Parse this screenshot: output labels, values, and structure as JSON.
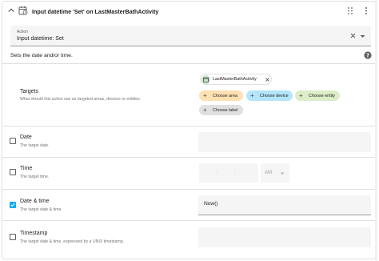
{
  "header": {
    "title": "Input datetime 'Set' on LastMasterBathActivity"
  },
  "action": {
    "label": "Action",
    "value": "Input datetime: Set"
  },
  "description": "Sets the date and/or time.",
  "targets": {
    "title": "Targets",
    "description": "What should this action use as targeted areas, devices or entities.",
    "entity": "LastMasterBathActivity",
    "chips": {
      "area": "Choose area",
      "device": "Choose device",
      "entity": "Choose entity",
      "label": "Choose label"
    }
  },
  "fields": {
    "date": {
      "title": "Date",
      "description": "The target date.",
      "checked": false
    },
    "time": {
      "title": "Time",
      "description": "The target time.",
      "checked": false,
      "ampm": "AM",
      "sep": ":"
    },
    "datetime": {
      "title": "Date & time",
      "description": "The target date & time.",
      "checked": true,
      "value": "Now()"
    },
    "timestamp": {
      "title": "Timestamp",
      "description": "The target date & time, expressed by a UNIX timestamp.",
      "checked": false
    }
  },
  "colors": {
    "accent": "#03a9f4",
    "area_chip": "#ffe0b2",
    "device_chip": "#b3e5fc",
    "entity_chip": "#dcedc8",
    "label_chip": "#e0e0e0"
  }
}
